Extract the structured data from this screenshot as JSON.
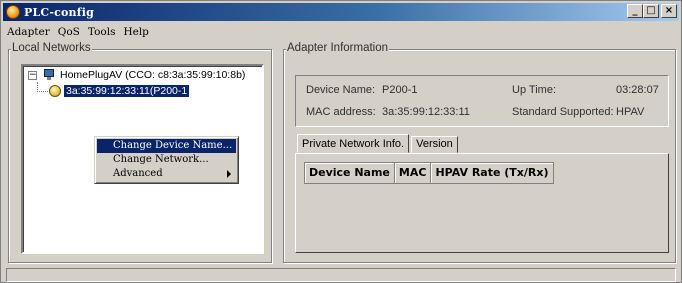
{
  "window": {
    "title": "PLC-config",
    "icon": "app-icon",
    "buttons": {
      "minimize": "_",
      "maximize": "□",
      "close": "×"
    }
  },
  "menubar": {
    "items": [
      "Adapter",
      "QoS",
      "Tools",
      "Help"
    ]
  },
  "local_networks": {
    "label": "Local Networks",
    "tree": {
      "root": {
        "expander": "−",
        "text": "HomePlugAV (CCO: c8:3a:35:99:10:8b)"
      },
      "child": {
        "text": "3a:35:99:12:33:11(P200-1"
      }
    },
    "context_menu": {
      "items": [
        {
          "label": "Change Device Name...",
          "highlighted": true
        },
        {
          "label": "Change Network...",
          "highlighted": false
        },
        {
          "label": "Advanced",
          "submenu": true
        }
      ]
    }
  },
  "adapter_info": {
    "label": "Adapter Information",
    "fields": {
      "device_name_label": "Device Name:",
      "device_name_value": "P200-1",
      "mac_label": "MAC address:",
      "mac_value": "3a:35:99:12:33:11",
      "uptime_label": "Up Time:",
      "uptime_value": "03:28:07",
      "standard_label": "Standard Supported:",
      "standard_value": "HPAV"
    },
    "tabs": [
      {
        "label": "Private Network Info.",
        "active": true
      },
      {
        "label": "Version",
        "active": false
      }
    ],
    "grid_columns": [
      "Device Name",
      "MAC",
      "HPAV Rate (Tx/Rx)"
    ]
  },
  "colors": {
    "title_gradient_start": "#0a246a",
    "title_gradient_end": "#a6caf0",
    "selection": "#0a246a",
    "face": "#d4d0c8"
  }
}
